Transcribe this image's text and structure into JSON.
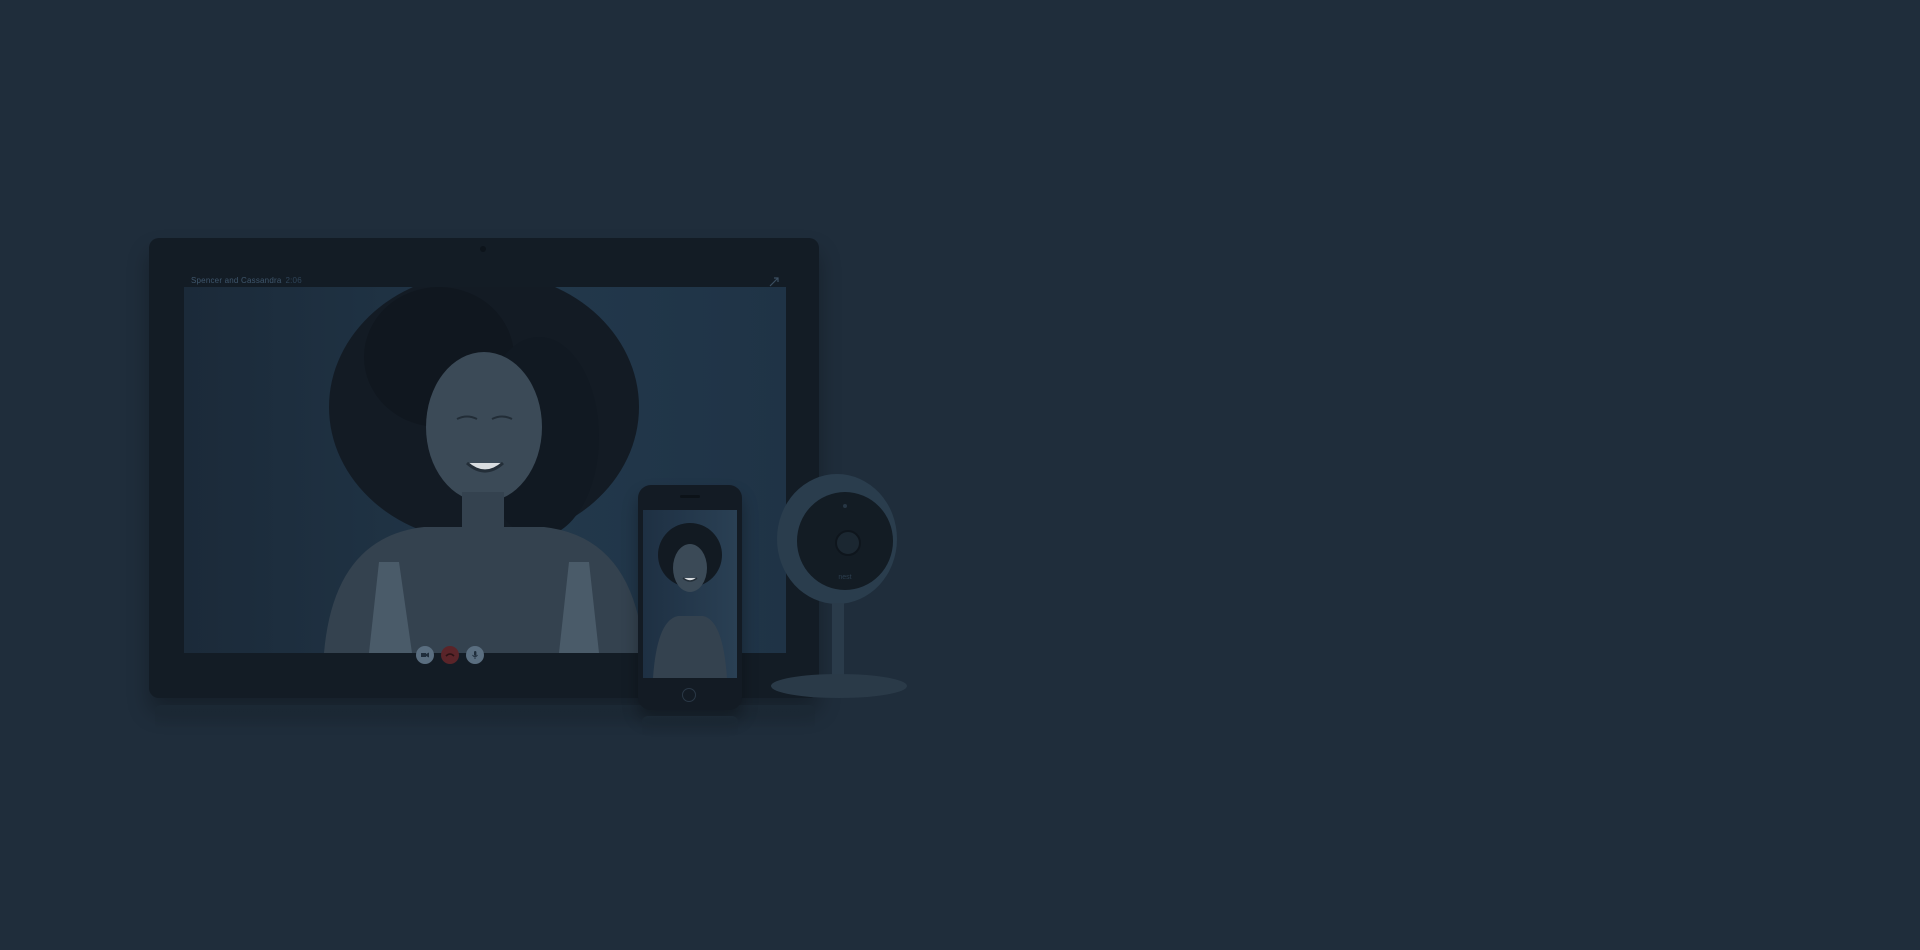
{
  "hero": {
    "tablet": {
      "call_title": "Spencer and Cassandra",
      "call_duration": "2:06"
    },
    "camera": {
      "logo": "nest"
    }
  },
  "icons": {
    "expand": "expand-icon",
    "camera_toggle": "video-camera-icon",
    "end_call": "end-call-icon",
    "microphone": "microphone-icon"
  },
  "colors": {
    "page_background": "#1f2d3b",
    "device_frame": "#131c25",
    "end_call": "#5a2429"
  }
}
